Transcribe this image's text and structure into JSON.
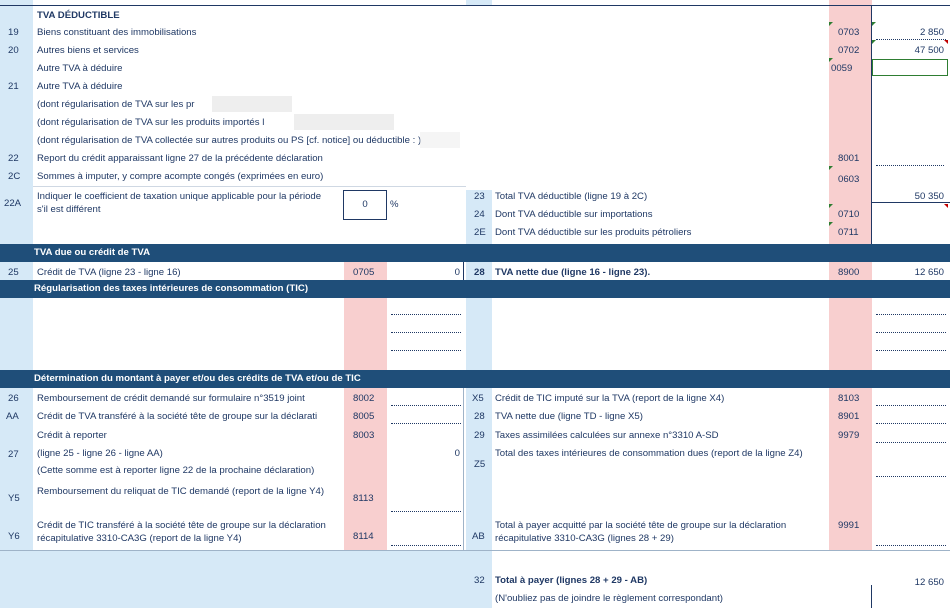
{
  "sec_tva_deductible": "TVA DÉDUCTIBLE",
  "rows_top": [
    {
      "n": "19",
      "label": "Biens constituant des immobilisations",
      "code": "0703",
      "val": "2 850"
    },
    {
      "n": "20",
      "label": "Autres biens et services",
      "code": "0702",
      "val": "47 500"
    },
    {
      "n": "",
      "label": "Autre TVA à déduire",
      "code": "0059",
      "val": ""
    },
    {
      "n": "21",
      "label": "Autre TVA à déduire",
      "code": "",
      "val": ""
    },
    {
      "n": "",
      "label": "(dont régularisation de TVA sur les pr",
      "code": "",
      "val": ""
    },
    {
      "n": "",
      "label": "(dont régularisation de TVA sur les produits importés l",
      "code": "",
      "val": ""
    },
    {
      "n": "",
      "label": "(dont régularisation de TVA collectée sur autres produits ou PS [cf. notice] ou déductible :  )",
      "code": "",
      "val": ""
    },
    {
      "n": "22",
      "label": "Report du crédit apparaissant ligne 27 de la précédente déclaration",
      "code": "8001",
      "val": ""
    },
    {
      "n": "2C",
      "label": "Sommes à imputer, y compre acompte congés (exprimées en euro)",
      "code": "0603",
      "val": ""
    }
  ],
  "r22a": {
    "n": "22A",
    "label": "Indiquer le coefficient de taxation unique applicable pour la période s'il est différent",
    "value": "0",
    "unit": "%"
  },
  "r23": {
    "n": "23",
    "label": "Total TVA déductible (ligne 19 à 2C)",
    "val": "50 350"
  },
  "r24": {
    "n": "24",
    "label": "Dont TVA déductible sur importations",
    "code": "0710"
  },
  "r2e": {
    "n": "2E",
    "label": "Dont TVA déductible sur les produits pétroliers",
    "code": "0711"
  },
  "sec_tva_due": "TVA due ou crédit de TVA",
  "r25": {
    "n": "25",
    "label": "Crédit de TVA (ligne 23 - ligne 16)",
    "code": "0705",
    "val": "0"
  },
  "r28": {
    "n": "28",
    "label": "TVA nette due (ligne 16 - ligne 23).",
    "code": "8900",
    "val": "12 650"
  },
  "sec_tic": "Régularisation des taxes intérieures de consommation (TIC)",
  "sec_det": "Détermination du montant à payer et/ou des crédits de TVA et/ou de TIC",
  "left_rows": [
    {
      "n": "26",
      "label": "Remboursement de crédit demandé sur formulaire n°3519 joint",
      "code": "8002"
    },
    {
      "n": "AA",
      "label": "Crédit de TVA transféré à la société tête de groupe sur la déclarati",
      "code": "8005"
    },
    {
      "n": "",
      "label": "Crédit à reporter",
      "code": "8003"
    },
    {
      "n": "27",
      "label": "(ligne 25 - ligne 26 - ligne AA)",
      "val": "0"
    },
    {
      "n": "",
      "label": "(Cette somme est à reporter ligne 22 de la prochaine déclaration)"
    },
    {
      "n": "Y5",
      "label": "Remboursement du reliquat de TIC demandé (report de la ligne Y4)",
      "code": "8113"
    },
    {
      "n": "Y6",
      "label": "Crédit de TIC transféré à la société tête de groupe sur la déclaration récapitulative 3310-CA3G (report de la ligne Y4)",
      "code": "8114"
    }
  ],
  "right_rows": [
    {
      "n": "X5",
      "label": "Crédit de TIC imputé sur la TVA (report de la ligne X4)",
      "code": "8103"
    },
    {
      "n": "28",
      "label": "TVA nette due (ligne TD - ligne X5)",
      "code": "8901"
    },
    {
      "n": "29",
      "label": "Taxes assimilées calculées sur annexe n°3310 A-SD",
      "code": "9979"
    },
    {
      "n": "Z5",
      "label": "Total des taxes intérieures de consommation dues (report de la ligne Z4)",
      "code": ""
    },
    {
      "n": "AB",
      "label": "Total à payer acquitté par la société tête de groupe sur la déclaration récapitulative 3310-CA3G (lignes 28 + 29)",
      "code": "9991"
    }
  ],
  "r32": {
    "n": "32",
    "label": "Total à payer (lignes 28 + 29 - AB)",
    "val": "12 650",
    "note": "(N'oubliez pas de joindre le règlement correspondant)"
  },
  "colors": {
    "band": "#1f4e79",
    "light_blue": "#d6e9f7",
    "pink": "#f8cfcf",
    "text": "#1f3864"
  }
}
